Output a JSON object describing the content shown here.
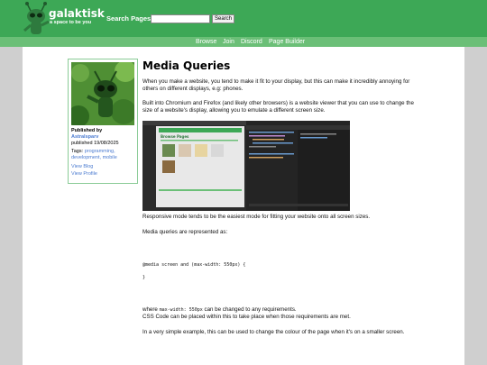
{
  "header": {
    "site_name": "galaktisk",
    "tagline": "a space to be you",
    "search_label": "Search Pages:",
    "search_value": "",
    "search_button": "Search"
  },
  "nav": {
    "items": [
      "Browse",
      "Join",
      "Discord",
      "Page Builder"
    ]
  },
  "sidebar": {
    "published_by_label": "Published by",
    "author": "Astralsparv",
    "published_date": "published 19/08/2025",
    "tags_label": "Tags:",
    "tags": [
      "programming,",
      "development,",
      "mobile"
    ],
    "view_blog": "View Blog",
    "view_profile": "View Profile"
  },
  "article": {
    "title": "Media Queries",
    "p1": "When you make a website, you tend to make it fit to your display, but this can make it incredibly annoying for others on different displays, e.g: phones.",
    "p2": "Built into Chromium and Firefox (and likely other browsers) is a website viewer that you can use to change the size of a website's display, allowing you to emulate a different screen size.",
    "p3": "Responsive mode tends to be the easiest mode for fitting your website onto all screen sizes.",
    "p4": "Media queries are represented as:",
    "code1": "@media screen and (max-width: 550px) {",
    "code2": "}",
    "p5_pre": "where ",
    "p5_code": "max-width: 550px",
    "p5_post": " can be changed to any requirements.",
    "p6": "CSS Code can be placed within this to take place when those requirements are met.",
    "p7": "In a very simple example, this can be used to change the colour of the page when it's on a smaller screen."
  },
  "screenshot": {
    "inner_title": "Browse Pages"
  },
  "colors": {
    "header_green": "#3da856",
    "nav_green": "#6bbf77",
    "link_blue": "#4b7bd0",
    "page_bg": "#cfcfcf"
  }
}
